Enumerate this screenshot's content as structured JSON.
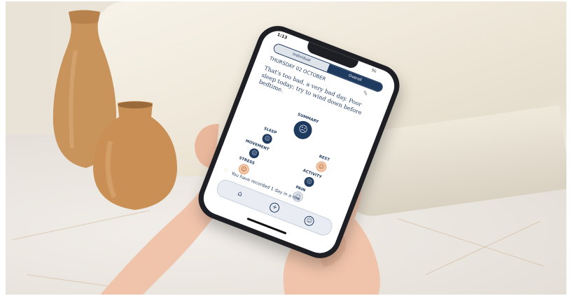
{
  "status": {
    "time": "1:13",
    "battery": "5G"
  },
  "segmented_control": {
    "options": [
      "Individual",
      "Overall"
    ],
    "selected": "Overall"
  },
  "day": {
    "date": "THURSDAY 02 OCTOBER",
    "message": "That's too bad, a very bad day. Poor sleep today; try to wind down before bedtime."
  },
  "summary": {
    "label": "SUMMARY"
  },
  "metrics": [
    {
      "label": "SLEEP",
      "mood": "very-bad-face-icon"
    },
    {
      "label": "REST",
      "mood": "okay-face-icon"
    },
    {
      "label": "MOVEMENT",
      "mood": "bad-face-icon"
    },
    {
      "label": "ACTIVITY",
      "mood": "bad-face-icon"
    },
    {
      "label": "STRESS",
      "mood": "okay-face-icon"
    },
    {
      "label": "PAIN",
      "mood": "neutral-face-icon"
    }
  ],
  "record": {
    "text": "You have recorded 1 day in a row"
  },
  "nav": {
    "items": [
      "home-icon",
      "add-icon",
      "profile-icon"
    ]
  },
  "colors": {
    "primary": "#1f3a5f",
    "accent": "#f5c7a6",
    "neutral": "#dfe4ea"
  }
}
